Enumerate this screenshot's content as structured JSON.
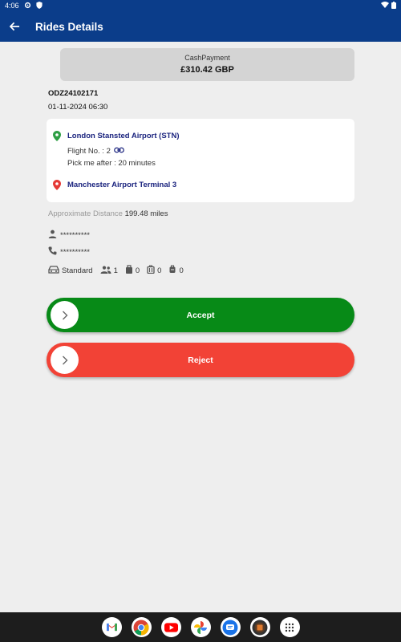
{
  "status_bar": {
    "time": "4:06"
  },
  "app_bar": {
    "title": "Rides Details"
  },
  "payment": {
    "method": "CashPayment",
    "amount": "£310.42 GBP"
  },
  "booking": {
    "id": "ODZ24102171",
    "datetime": "01-11-2024 06:30"
  },
  "route": {
    "pickup": "London Stansted Airport (STN)",
    "flight_no": "Flight No. : 2",
    "pickup_after": "Pick me after : 20 minutes",
    "dropoff": "Manchester Airport Terminal 3"
  },
  "distance": {
    "label": "Approximate Distance",
    "value": "199.48 miles"
  },
  "passenger": {
    "name": "**********",
    "phone": "**********"
  },
  "vehicle": {
    "type": "Standard",
    "passengers": "1",
    "bags": "0",
    "suitcases": "0",
    "extra": "0"
  },
  "actions": {
    "accept_label": "Accept",
    "reject_label": "Reject"
  },
  "colors": {
    "primary": "#0b3d8a",
    "accept": "#078a17",
    "reject": "#f24236",
    "pickup_pin": "#2e9e44",
    "dropoff_pin": "#e53935"
  },
  "nav_apps": [
    "gmail-icon",
    "chrome-icon",
    "youtube-icon",
    "photos-icon",
    "messages-icon",
    "camera-icon",
    "app-drawer-icon"
  ]
}
